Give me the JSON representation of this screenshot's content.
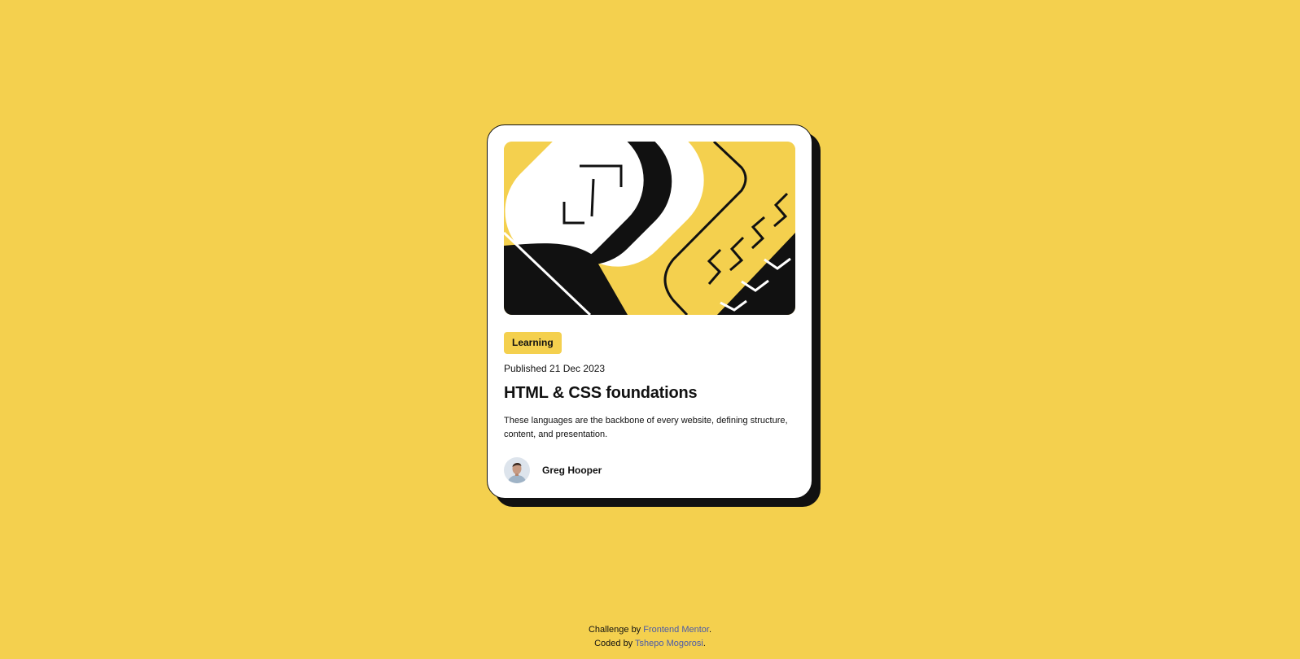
{
  "card": {
    "tag": "Learning",
    "published": "Published 21 Dec 2023",
    "title": "HTML & CSS foundations",
    "description": "These languages are the backbone of every website, defining structure, content, and presentation.",
    "author": {
      "name": "Greg Hooper"
    }
  },
  "attribution": {
    "challenge_prefix": "Challenge by",
    "challenge_link": "Frontend Mentor",
    "coded_prefix": "Coded by",
    "coded_link": "Tshepo Mogorosi",
    "period": "."
  },
  "colors": {
    "background": "#f4d04e",
    "card": "#ffffff",
    "ink": "#111111",
    "link": "#4a5aa8"
  },
  "icons": [
    "illustration-article",
    "author-avatar"
  ]
}
